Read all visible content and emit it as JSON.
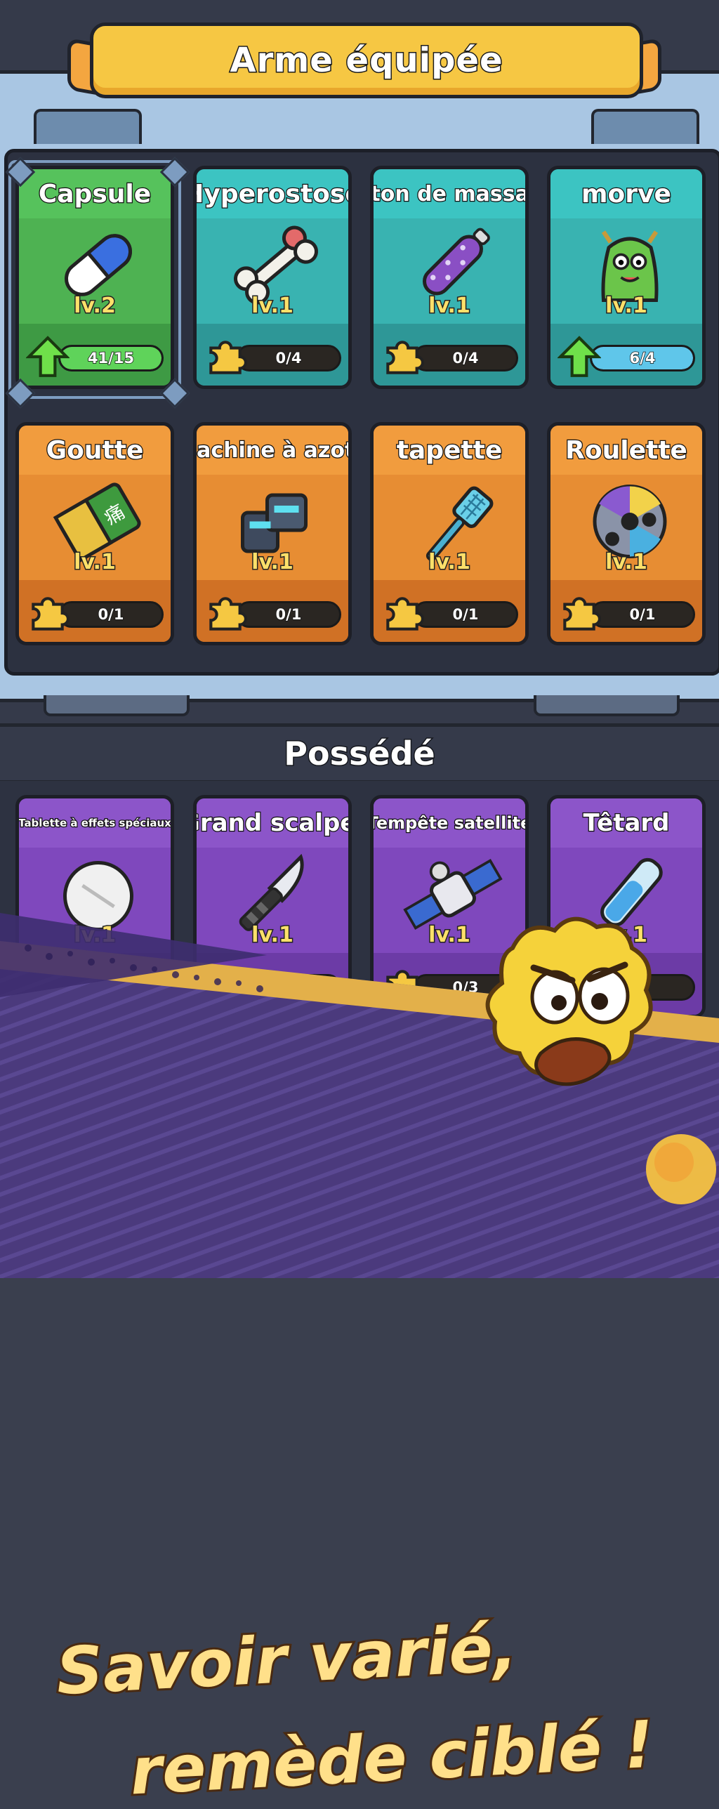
{
  "header": {
    "title": "Arme équipée"
  },
  "equipped": [
    {
      "name": "Capsule",
      "level": "lv.2",
      "progress": "41/15",
      "progress_pct": 100,
      "color": "green",
      "icon": "pill-capsule-icon",
      "upgrade": true
    },
    {
      "name": "Hyperostose",
      "level": "lv.1",
      "progress": "0/4",
      "progress_pct": 0,
      "color": "teal",
      "icon": "bone-icon",
      "upgrade": false
    },
    {
      "name": "Bâton de massage",
      "level": "lv.1",
      "progress": "0/4",
      "progress_pct": 0,
      "color": "teal",
      "icon": "massage-stick-icon",
      "upgrade": false
    },
    {
      "name": "morve",
      "level": "lv.1",
      "progress": "6/4",
      "progress_pct": 100,
      "color": "teal",
      "icon": "snot-monster-icon",
      "upgrade": true
    },
    {
      "name": "Goutte",
      "level": "lv.1",
      "progress": "0/1",
      "progress_pct": 0,
      "color": "orange",
      "icon": "gout-plaster-icon",
      "upgrade": false
    },
    {
      "name": "Machine à azote",
      "level": "lv.1",
      "progress": "0/1",
      "progress_pct": 0,
      "color": "orange",
      "icon": "nitrogen-machine-icon",
      "upgrade": false
    },
    {
      "name": "tapette",
      "level": "lv.1",
      "progress": "0/1",
      "progress_pct": 0,
      "color": "orange",
      "icon": "fly-swatter-icon",
      "upgrade": false
    },
    {
      "name": "Roulette",
      "level": "lv.1",
      "progress": "0/1",
      "progress_pct": 0,
      "color": "orange",
      "icon": "roulette-wheel-icon",
      "upgrade": false
    }
  ],
  "owned_section": {
    "title": "Possédé"
  },
  "owned": [
    {
      "name": "Tablette à effets spéciaux",
      "level": "lv.1",
      "progress": "",
      "color": "purple",
      "icon": "tablet-icon"
    },
    {
      "name": "Grand scalpel",
      "level": "lv.1",
      "progress": "0/3",
      "color": "purple",
      "icon": "scalpel-icon"
    },
    {
      "name": "Tempête satellite",
      "level": "lv.1",
      "progress": "0/3",
      "color": "purple",
      "icon": "satellite-icon"
    },
    {
      "name": "Têtard",
      "level": "lv.1",
      "progress": "",
      "color": "purple",
      "icon": "test-tube-icon"
    }
  ],
  "promo": {
    "line1": "Savoir varié,",
    "line2": "remède ciblé !"
  },
  "colors": {
    "banner": "#f6c743",
    "level_text": "#fde06a",
    "slogan": "#ffe08a"
  }
}
